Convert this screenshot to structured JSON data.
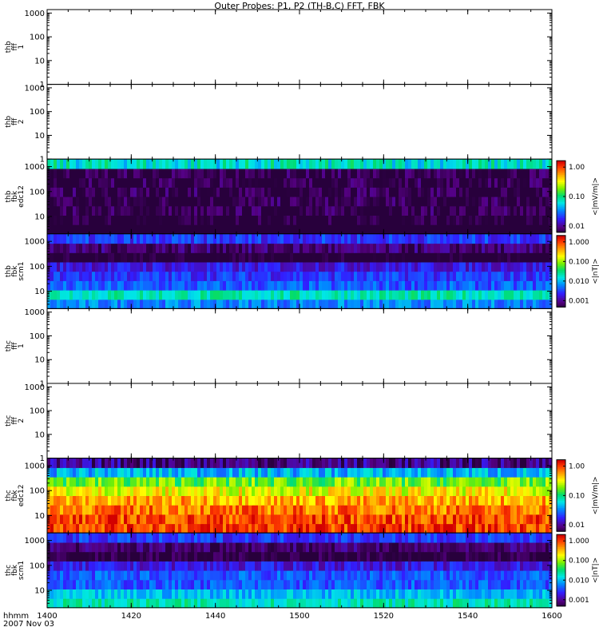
{
  "chart_data": {
    "type": "heatmap",
    "title": "Outer Probes: P1, P2 (TH-B,C) FFT, FBK",
    "x_ticks": [
      "1400",
      "1420",
      "1440",
      "1500",
      "1520",
      "1540",
      "1600"
    ],
    "x_range": [
      "14:00",
      "16:00"
    ],
    "x_label_lines": [
      "hhmm",
      "2007 Nov 03"
    ],
    "panels": [
      {
        "label_lines": [
          "thb",
          "fff",
          "1"
        ],
        "y_ticks": [
          "1000",
          "100",
          "10",
          "1"
        ],
        "ylim": [
          1,
          1400
        ],
        "yscale": "log",
        "kind": "empty"
      },
      {
        "label_lines": [
          "thb",
          "fff",
          "2"
        ],
        "y_ticks": [
          "1000",
          "100",
          "10",
          "1"
        ],
        "ylim": [
          1,
          1400
        ],
        "yscale": "log",
        "kind": "empty"
      },
      {
        "label_lines": [
          "thb",
          "fbk",
          "edc12"
        ],
        "y_ticks": [
          "1000",
          "100",
          "10"
        ],
        "ylim": [
          2,
          2000
        ],
        "yscale": "log",
        "kind": "spectrogram",
        "bands_low_to_high": [
          0.002,
          0.004,
          0.005,
          0.005,
          0.005,
          0.005,
          0.005,
          0.06
        ],
        "colorbar": {
          "label": "<|mV/m|>",
          "ticks": [
            "1.00",
            "0.10",
            "0.01"
          ],
          "range": [
            0.005,
            1.5
          ]
        }
      },
      {
        "label_lines": [
          "thb",
          "fbk",
          "scm1"
        ],
        "y_ticks": [
          "1000",
          "100",
          "10"
        ],
        "ylim": [
          2,
          2000
        ],
        "yscale": "log",
        "kind": "spectrogram",
        "bands_low_to_high": [
          0.006,
          0.02,
          0.004,
          0.003,
          0.002,
          0.0004,
          0.0008,
          0.003
        ],
        "colorbar": {
          "label": "<|nT|>",
          "ticks": [
            "1.000",
            "0.100",
            "0.010",
            "0.001"
          ],
          "range": [
            0.0005,
            1.5
          ]
        }
      },
      {
        "label_lines": [
          "thc",
          "fff",
          "1"
        ],
        "y_ticks": [
          "1000",
          "100",
          "10",
          "1"
        ],
        "ylim": [
          1,
          1400
        ],
        "yscale": "log",
        "kind": "empty"
      },
      {
        "label_lines": [
          "thc",
          "fff",
          "2"
        ],
        "y_ticks": [
          "1000",
          "100",
          "10",
          "1"
        ],
        "ylim": [
          1,
          1400
        ],
        "yscale": "log",
        "kind": "empty"
      },
      {
        "label_lines": [
          "thc",
          "fbk",
          "edc12"
        ],
        "y_ticks": [
          "1000",
          "100",
          "10"
        ],
        "ylim": [
          2,
          2000
        ],
        "yscale": "log",
        "kind": "spectrogram",
        "bands_low_to_high": [
          1.0,
          0.9,
          0.7,
          0.5,
          0.3,
          0.15,
          0.04,
          0.008
        ],
        "colorbar": {
          "label": "<|mV/m|>",
          "ticks": [
            "1.00",
            "0.10",
            "0.01"
          ],
          "range": [
            0.005,
            1.5
          ]
        }
      },
      {
        "label_lines": [
          "thc",
          "fbk",
          "scm1"
        ],
        "y_ticks": [
          "1000",
          "100",
          "10"
        ],
        "ylim": [
          2,
          2000
        ],
        "yscale": "log",
        "kind": "spectrogram",
        "bands_low_to_high": [
          0.02,
          0.01,
          0.004,
          0.004,
          0.002,
          0.0005,
          0.0008,
          0.003
        ],
        "colorbar": {
          "label": "<|nT|>",
          "ticks": [
            "1.000",
            "0.100",
            "0.010",
            "0.001"
          ],
          "range": [
            0.0005,
            1.5
          ]
        }
      }
    ]
  }
}
